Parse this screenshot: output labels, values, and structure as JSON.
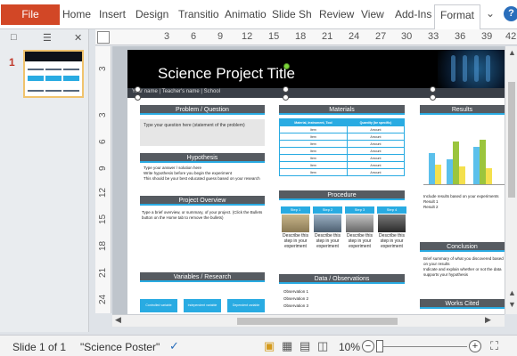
{
  "ribbon": {
    "file": "File",
    "tabs": [
      "Home",
      "Insert",
      "Design",
      "Transitio",
      "Animatio",
      "Slide Sh",
      "Review",
      "View",
      "Add-Ins",
      "Format"
    ],
    "active_tab": "Format",
    "help": "?"
  },
  "thumbnails": {
    "slide_number": "1"
  },
  "hruler": [
    "3",
    "6",
    "9",
    "12",
    "15",
    "18",
    "21",
    "24",
    "27",
    "30",
    "33",
    "36",
    "39",
    "42"
  ],
  "vruler": [
    "3",
    "3",
    "6",
    "9",
    "12",
    "15",
    "18",
    "21",
    "24"
  ],
  "slide": {
    "title": "Science Project Title",
    "subtitle": "Your name | Teacher's name | School",
    "sections": {
      "problem": "Problem / Question",
      "hypothesis": "Hypothesis",
      "overview": "Project Overview",
      "variables": "Variables / Research",
      "materials": "Materials",
      "procedure": "Procedure",
      "data": "Data / Observations",
      "results": "Results",
      "conclusion": "Conclusion",
      "works_cited": "Works Cited"
    },
    "problem_text": "Type your question here (statement of the problem)",
    "hypothesis_text": [
      "Type your answer / solution here",
      "Write hypothesis before you begin the experiment",
      "This should be your best educated guess based on your research"
    ],
    "overview_text": "Type a brief overview, or summary, of your project. (Click the Bullets button on the Home tab to remove the bullets)",
    "materials_header": [
      "Material, Instrument, Tool",
      "Quantity (be specific)"
    ],
    "materials_rows": [
      [
        "Item",
        "Amount"
      ],
      [
        "Item",
        "Amount"
      ],
      [
        "Item",
        "Amount"
      ],
      [
        "Item",
        "Amount"
      ],
      [
        "Item",
        "Amount"
      ],
      [
        "Item",
        "Amount"
      ],
      [
        "Item",
        "Amount"
      ]
    ],
    "steps": [
      {
        "label": "Step 1",
        "text": "Describe this step in your experiment"
      },
      {
        "label": "Step 2",
        "text": "Describe this step in your experiment"
      },
      {
        "label": "Step 3",
        "text": "Describe this step in your experiment"
      },
      {
        "label": "Step 4",
        "text": "Describe this step in your experiment"
      }
    ],
    "variables": [
      "Controlled variable",
      "Independent variable",
      "Dependent variable"
    ],
    "observations": [
      "Observation 1",
      "Observation 2",
      "Observation 3"
    ],
    "results_text": [
      "Include results based on your experiments",
      "Result 1",
      "Result 2"
    ],
    "conclusion_text": [
      "Brief summary of what you discovered based on your results",
      "Indicate and explain whether or not the data supports your hypothesis"
    ]
  },
  "status": {
    "slide": "Slide 1 of 1",
    "theme": "\"Science Poster\"",
    "zoom": "10%"
  },
  "colors": {
    "accent": "#29abe2",
    "file_tab": "#d24726",
    "section_header": "#565b61"
  }
}
